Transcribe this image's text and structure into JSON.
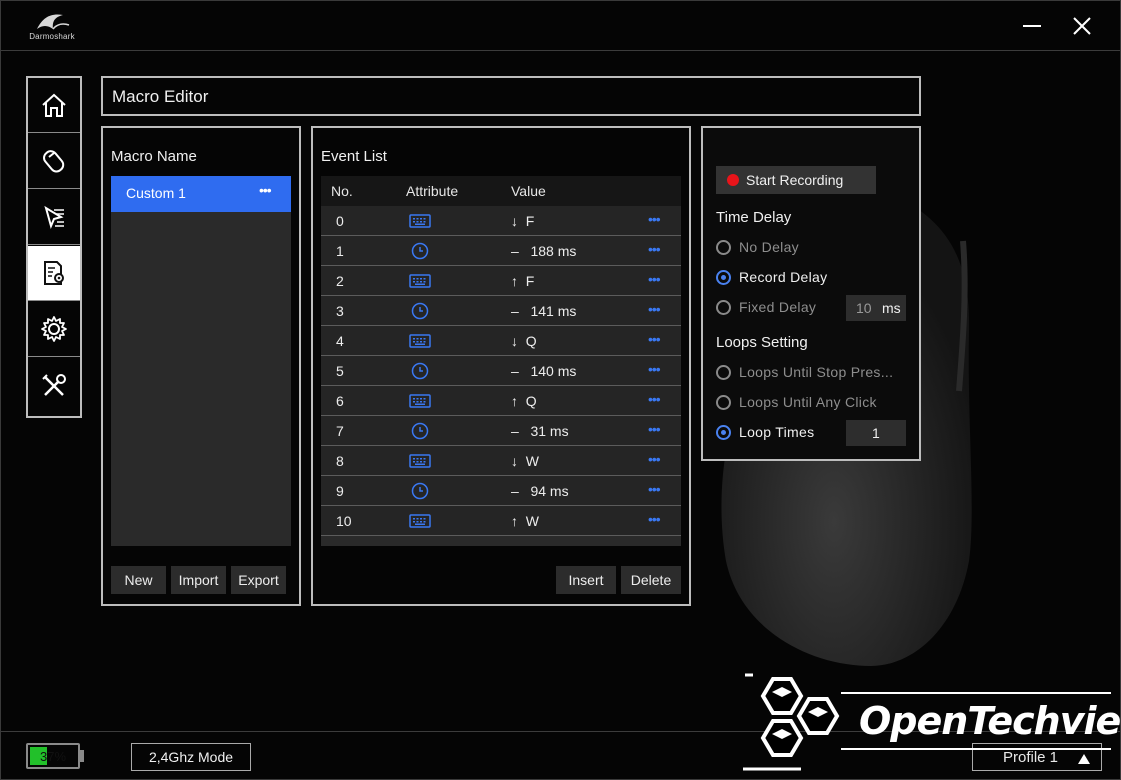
{
  "brand": {
    "name": "Darmoshark"
  },
  "window": {
    "minimize_icon": "minimize-icon",
    "close_icon": "close-icon"
  },
  "sidebar": {
    "items": [
      {
        "id": "home",
        "icon": "home-icon"
      },
      {
        "id": "lighting",
        "icon": "tag-icon"
      },
      {
        "id": "performance",
        "icon": "cursor-icon"
      },
      {
        "id": "macro",
        "icon": "macro-icon",
        "active": true
      },
      {
        "id": "settings",
        "icon": "gear-icon"
      },
      {
        "id": "tools",
        "icon": "tools-icon"
      }
    ]
  },
  "header": {
    "title": "Macro Editor"
  },
  "macro_panel": {
    "title": "Macro Name",
    "items": [
      {
        "label": "Custom 1",
        "more": "•••"
      }
    ],
    "buttons": {
      "new": "New",
      "import": "Import",
      "export": "Export"
    }
  },
  "event_panel": {
    "title": "Event List",
    "columns": {
      "no": "No.",
      "attribute": "Attribute",
      "value": "Value"
    },
    "rows": [
      {
        "no": "0",
        "attribute": "keyboard-icon",
        "value": "↓  F",
        "more": "•••"
      },
      {
        "no": "1",
        "attribute": "clock-icon",
        "value": "–   188 ms",
        "more": "•••"
      },
      {
        "no": "2",
        "attribute": "keyboard-icon",
        "value": "↑  F",
        "more": "•••"
      },
      {
        "no": "3",
        "attribute": "clock-icon",
        "value": "–   141 ms",
        "more": "•••"
      },
      {
        "no": "4",
        "attribute": "keyboard-icon",
        "value": "↓  Q",
        "more": "•••"
      },
      {
        "no": "5",
        "attribute": "clock-icon",
        "value": "–   140 ms",
        "more": "•••"
      },
      {
        "no": "6",
        "attribute": "keyboard-icon",
        "value": "↑  Q",
        "more": "•••"
      },
      {
        "no": "7",
        "attribute": "clock-icon",
        "value": "–   31 ms",
        "more": "•••"
      },
      {
        "no": "8",
        "attribute": "keyboard-icon",
        "value": "↓  W",
        "more": "•••"
      },
      {
        "no": "9",
        "attribute": "clock-icon",
        "value": "–   94 ms",
        "more": "•••"
      },
      {
        "no": "10",
        "attribute": "keyboard-icon",
        "value": "↑  W",
        "more": "•••"
      }
    ],
    "buttons": {
      "insert": "Insert",
      "delete": "Delete"
    }
  },
  "settings_panel": {
    "record_button": "Start Recording",
    "time_delay": {
      "title": "Time Delay",
      "options": {
        "no_delay": "No Delay",
        "record_delay": "Record Delay",
        "fixed_delay": "Fixed Delay"
      },
      "selected": "record_delay",
      "fixed_value": "10",
      "fixed_unit": "ms"
    },
    "loops": {
      "title": "Loops Setting",
      "options": {
        "until_stop": "Loops Until Stop Pres...",
        "until_click": "Loops Until Any Click",
        "loop_times": "Loop Times"
      },
      "selected": "loop_times",
      "times_value": "1"
    }
  },
  "status": {
    "battery": "37%",
    "battery_level": 0.37,
    "mode": "2,4Ghz Mode",
    "profile": "Profile 1"
  },
  "watermark": {
    "text": "OpenTechview"
  },
  "colors": {
    "accent": "#2f6cf0",
    "record": "#e8141a",
    "battery": "#22c02a"
  }
}
